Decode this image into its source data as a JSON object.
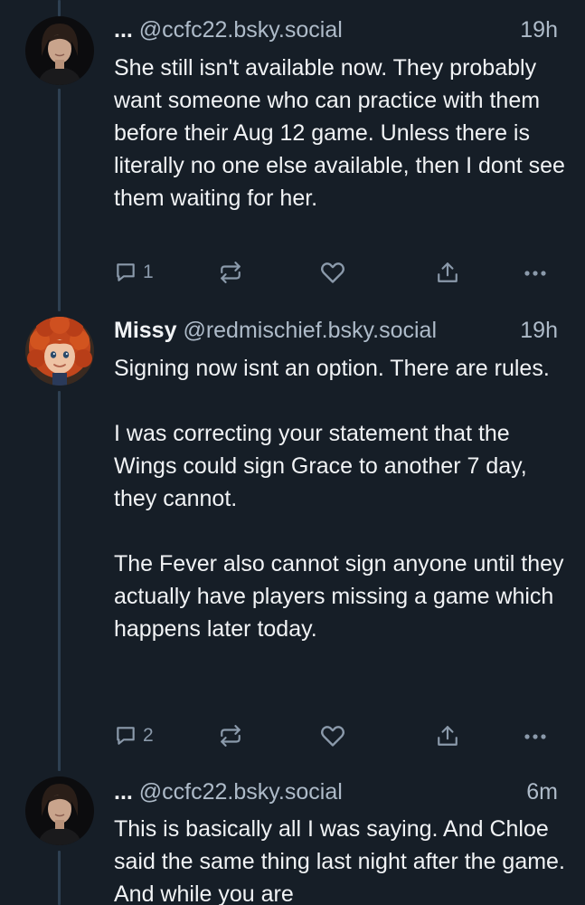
{
  "posts": [
    {
      "author_name": "...",
      "handle": "@ccfc22.bsky.social",
      "time": "19h",
      "paragraphs": [
        "She still isn't available now. They probably want someone who can practice with them before their Aug 12 game. Unless there is literally no one else available, then I dont see them waiting for her."
      ],
      "reply_count": "1",
      "avatar": "person-portrait-dark-hair"
    },
    {
      "author_name": "Missy",
      "handle": "@redmischief.bsky.social",
      "time": "19h",
      "paragraphs": [
        "Signing now isnt an option. There are rules.",
        "I was correcting your statement that the Wings could sign Grace to another 7 day, they cannot.",
        "The Fever also cannot sign anyone until they actually have players missing a game  which happens later today."
      ],
      "reply_count": "2",
      "avatar": "red-curly-hair-character"
    },
    {
      "author_name": "...",
      "handle": "@ccfc22.bsky.social",
      "time": "6m",
      "paragraphs": [
        "This is basically all I was saying. And Chloe said the same thing last night after the game. And while you are"
      ],
      "reply_count": "",
      "avatar": "person-portrait-dark-hair"
    }
  ],
  "icons": {
    "reply": "reply-icon",
    "repost": "repost-icon",
    "like": "heart-icon",
    "share": "share-icon",
    "more": "more-options-icon"
  },
  "colors": {
    "background": "#161e27",
    "text": "#f1f3f5",
    "secondary_text": "#aebbc9",
    "icon": "#8b9aab",
    "thread_line": "#2e4052"
  }
}
